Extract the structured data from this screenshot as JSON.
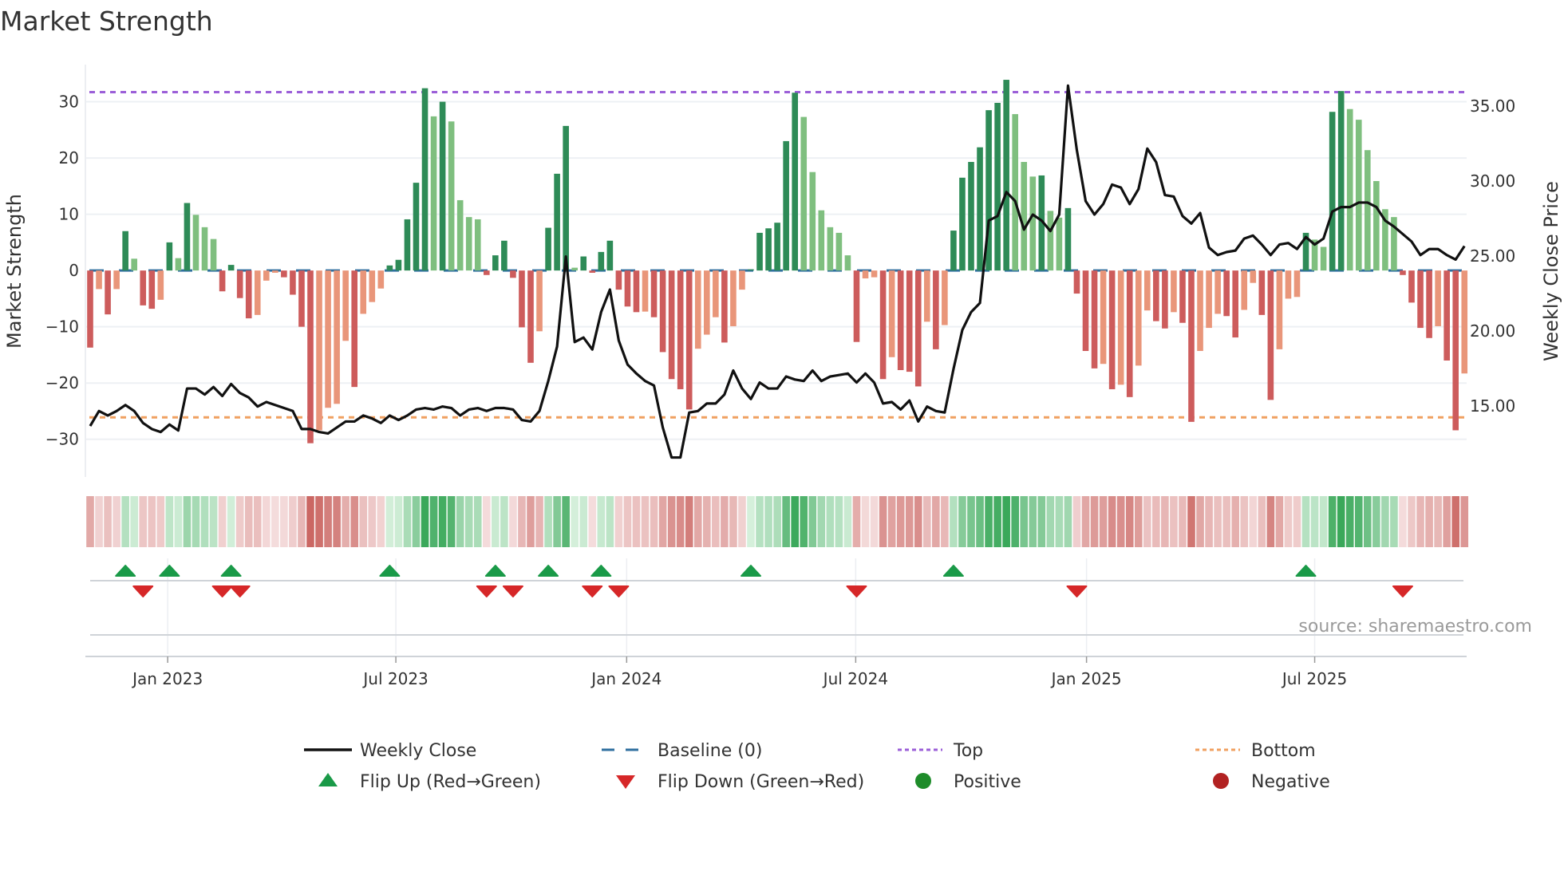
{
  "chart_data": {
    "type": "bar",
    "title": "Market Strength",
    "ylabel": "Market Strength",
    "y2label": "Weekly Close Price",
    "ylim": [
      -36.7,
      36.6
    ],
    "y2lim": [
      10.2,
      37.7
    ],
    "yticks": [
      30,
      20,
      10,
      0,
      -10,
      -20,
      -30
    ],
    "ytick_labels": [
      "30",
      "20",
      "10",
      "0",
      "−10",
      "−20",
      "−30"
    ],
    "y2ticks": [
      35,
      30,
      25,
      20,
      15
    ],
    "y2tick_labels": [
      "35.00",
      "30.00",
      "25.00",
      "20.00",
      "15.00"
    ],
    "top_level": 31.7,
    "bottom_level": -26.1,
    "baseline": 0,
    "xticks": [
      {
        "week": 8.8,
        "label": "Jan 2023"
      },
      {
        "week": 34.7,
        "label": "Jul 2023"
      },
      {
        "week": 60.9,
        "label": "Jan 2024"
      },
      {
        "week": 86.9,
        "label": "Jul 2024"
      },
      {
        "week": 113.1,
        "label": "Jan 2025"
      },
      {
        "week": 139.0,
        "label": "Jul 2025"
      }
    ],
    "series": [
      {
        "name": "Market Strength",
        "type": "bar",
        "values": [
          -13.7,
          -3.3,
          -7.8,
          -3.3,
          7.0,
          2.1,
          -6.2,
          -6.8,
          -5.2,
          5.0,
          2.2,
          12.0,
          9.9,
          7.7,
          5.6,
          -3.7,
          1.0,
          -4.9,
          -8.5,
          -7.9,
          -1.8,
          -0.4,
          -1.2,
          -4.3,
          -10.0,
          -30.7,
          -28.4,
          -24.4,
          -23.7,
          -12.5,
          -20.7,
          -7.7,
          -5.6,
          -3.2,
          0.9,
          1.9,
          9.1,
          15.6,
          32.4,
          27.4,
          30.0,
          26.5,
          12.5,
          9.5,
          9.1,
          -0.8,
          2.7,
          5.3,
          -1.3,
          -10.1,
          -16.4,
          -10.8,
          7.6,
          17.2,
          25.7,
          0.5,
          2.5,
          -0.4,
          3.3,
          5.3,
          -3.4,
          -6.4,
          -7.4,
          -7.3,
          -8.3,
          -14.5,
          -19.3,
          -21.1,
          -24.7,
          -13.9,
          -11.4,
          -8.3,
          -12.8,
          -9.9,
          -3.4,
          0.2,
          6.7,
          7.5,
          8.5,
          23.0,
          31.6,
          27.3,
          17.5,
          10.7,
          7.7,
          6.7,
          2.7,
          -12.7,
          -1.4,
          -1.2,
          -19.3,
          -15.4,
          -17.7,
          -18.0,
          -20.6,
          -9.1,
          -14.0,
          -9.7,
          7.1,
          16.5,
          19.3,
          21.9,
          28.5,
          29.8,
          33.9,
          27.8,
          19.3,
          16.7,
          16.9,
          10.6,
          9.4,
          11.1,
          -4.1,
          -14.3,
          -17.4,
          -16.6,
          -21.1,
          -20.3,
          -22.5,
          -16.9,
          -7.1,
          -9.0,
          -10.3,
          -7.4,
          -9.3,
          -26.9,
          -14.3,
          -10.2,
          -7.7,
          -8.1,
          -11.9,
          -7.0,
          -2.2,
          -7.9,
          -23.0,
          -14.0,
          -5.0,
          -4.7,
          6.7,
          5.5,
          4.2,
          28.2,
          31.9,
          28.7,
          26.8,
          21.4,
          15.9,
          10.9,
          9.5,
          -0.8,
          -5.7,
          -10.2,
          -12.0,
          -9.9,
          -16.0,
          -28.4,
          -18.3
        ]
      },
      {
        "name": "Weekly Close",
        "type": "line",
        "values": [
          13.6,
          14.6,
          14.3,
          14.6,
          15.0,
          14.6,
          13.8,
          13.4,
          13.2,
          13.7,
          13.3,
          16.1,
          16.1,
          15.7,
          16.2,
          15.6,
          16.4,
          15.8,
          15.5,
          14.9,
          15.2,
          15.0,
          14.8,
          14.6,
          13.4,
          13.4,
          13.2,
          13.1,
          13.5,
          13.9,
          13.9,
          14.3,
          14.1,
          13.8,
          14.3,
          14.0,
          14.3,
          14.7,
          14.8,
          14.7,
          14.9,
          14.8,
          14.3,
          14.7,
          14.8,
          14.6,
          14.8,
          14.8,
          14.7,
          14.0,
          13.9,
          14.6,
          16.6,
          18.9,
          24.9,
          19.2,
          19.5,
          18.7,
          21.2,
          22.7,
          19.3,
          17.7,
          17.1,
          16.6,
          16.3,
          13.5,
          11.5,
          11.5,
          14.5,
          14.6,
          15.1,
          15.1,
          15.7,
          17.3,
          16.1,
          15.4,
          16.5,
          16.1,
          16.1,
          16.9,
          16.7,
          16.6,
          17.3,
          16.6,
          16.9,
          17.0,
          17.1,
          16.5,
          17.1,
          16.5,
          15.1,
          15.2,
          14.7,
          15.3,
          13.9,
          14.9,
          14.6,
          14.5,
          17.4,
          20.0,
          21.2,
          21.8,
          27.3,
          27.6,
          29.2,
          28.6,
          26.7,
          27.7,
          27.3,
          26.6,
          27.7,
          36.3,
          32.0,
          28.6,
          27.7,
          28.4,
          29.7,
          29.5,
          28.4,
          29.4,
          32.1,
          31.2,
          29.0,
          28.9,
          27.6,
          27.1,
          27.8,
          25.5,
          25.0,
          25.2,
          25.3,
          26.1,
          26.3,
          25.7,
          25.0,
          25.7,
          25.8,
          25.4,
          26.2,
          25.7,
          26.1,
          27.9,
          28.2,
          28.2,
          28.5,
          28.5,
          28.2,
          27.3,
          26.9,
          26.4,
          25.9,
          25.0,
          25.4,
          25.4,
          25.0,
          24.7,
          25.6
        ]
      }
    ],
    "legend": {
      "placement": "bottom",
      "items": [
        {
          "label": "Weekly Close",
          "kind": "line"
        },
        {
          "label": "Baseline (0)",
          "kind": "dash"
        },
        {
          "label": "Top",
          "kind": "dot-purple"
        },
        {
          "label": "Bottom",
          "kind": "dot-orange"
        },
        {
          "label": "Flip Up (Red→Green)",
          "kind": "tri-up"
        },
        {
          "label": "Flip Down (Green→Red)",
          "kind": "tri-down"
        },
        {
          "label": "Positive",
          "kind": "dot-green"
        },
        {
          "label": "Negative",
          "kind": "dot-red"
        }
      ]
    },
    "source": "source: sharemaestro.com",
    "colors": {
      "strong_green": "#2e8b57",
      "weak_green": "#7fbf7f",
      "strong_red": "#cd5c5c",
      "weak_red": "#e9967a",
      "line": "#111111",
      "baseline": "#2f6f9f",
      "top": "#9b5fd8",
      "bottom": "#f0a060",
      "flip_up": "#1a9a48",
      "flip_down": "#d62728",
      "positive": "#1e8c2a",
      "negative": "#b22222"
    }
  }
}
